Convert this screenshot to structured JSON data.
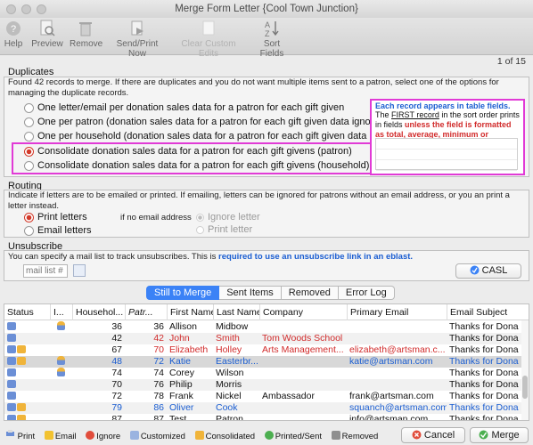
{
  "window": {
    "title": "Merge Form Letter {Cool Town Junction}"
  },
  "toolbar": {
    "help": "Help",
    "preview": "Preview",
    "remove": "Remove",
    "send_print": "Send/Print Now",
    "clear_custom": "Clear Custom Edits",
    "sort_fields": "Sort Fields"
  },
  "page_counter": "1 of 15",
  "duplicates": {
    "title": "Duplicates",
    "description": "Found 42 records to merge.  If there are duplicates and you do not want multiple items sent to a patron, select one of the options for managing the duplicate records.",
    "options": [
      {
        "label": "One letter/email per donation sales data for a patron for each gift given",
        "selected": false
      },
      {
        "label": "One per patron (donation sales data for a patron for each gift given data ignore",
        "selected": false
      },
      {
        "label": "One per household (donation sales data for a patron for each gift given data ig",
        "selected": false
      },
      {
        "label": "Consolidate donation sales data for a patron for each gift givens (patron)",
        "selected": true
      },
      {
        "label": "Consolidate donation sales data for a patron for each gift givens (household)",
        "selected": false
      }
    ],
    "side_title": "Each record appears in table fields.",
    "side_text_a": "The ",
    "side_text_first": "FIRST record",
    "side_text_b": " in the sort order prints in fields ",
    "side_text_red": "unless the field is formatted as total, average, minimum or"
  },
  "routing": {
    "title": "Routing",
    "description": "Indicate if letters are to be emailed or printed.  If emailing, letters can be ignored for patrons without an email address, or you an print a letter instead.",
    "print_letters": "Print letters",
    "email_letters": "Email letters",
    "if_no_email": "if no email address",
    "ignore_letter": "Ignore letter",
    "print_letter": "Print letter"
  },
  "unsubscribe": {
    "title": "Unsubscribe",
    "description_a": "You can specify a mail list to track unsubscribes.  This is ",
    "description_link": "required to use an unsubscribe link in an eblast.",
    "placeholder": "mail list #",
    "casl": "CASL"
  },
  "tabs": [
    "Still to Merge",
    "Sent Items",
    "Removed",
    "Error Log"
  ],
  "table": {
    "columns": [
      "Status",
      "I...",
      "Househol...",
      "Patr...",
      "First Name",
      "Last Name",
      "Company",
      "Primary Email",
      "Email Subject"
    ],
    "rows": [
      {
        "household": "36",
        "patron": "36",
        "first": "Allison",
        "last": "Midbow",
        "company": "",
        "email": "",
        "subject": "Thanks for Dona",
        "color": "black",
        "icons": [
          "print"
        ],
        "person": true
      },
      {
        "household": "42",
        "patron": "42",
        "first": "John",
        "last": "Smith",
        "company": "Tom Woods School",
        "email": "",
        "subject": "Thanks for Dona",
        "color": "red",
        "icons": [
          "print"
        ],
        "person": false
      },
      {
        "household": "67",
        "patron": "70",
        "first": "Elizabeth",
        "last": "Holley",
        "company": "Arts Management...",
        "email": "elizabeth@artsman.c...",
        "subject": "Thanks for Dona",
        "color": "red",
        "icons": [
          "print",
          "consolidated"
        ],
        "person": false
      },
      {
        "household": "48",
        "patron": "72",
        "first": "Katie",
        "last": "Easterbr...",
        "company": "",
        "email": "katie@artsman.com",
        "subject": "Thanks for Dona",
        "color": "blue",
        "icons": [
          "print",
          "consolidated"
        ],
        "person": true
      },
      {
        "household": "74",
        "patron": "74",
        "first": "Corey",
        "last": "Wilson",
        "company": "",
        "email": "",
        "subject": "Thanks for Dona",
        "color": "black",
        "icons": [
          "print"
        ],
        "person": true
      },
      {
        "household": "70",
        "patron": "76",
        "first": "Philip",
        "last": "Morris",
        "company": "",
        "email": "",
        "subject": "Thanks for Dona",
        "color": "black",
        "icons": [
          "print"
        ],
        "person": false
      },
      {
        "household": "72",
        "patron": "78",
        "first": "Frank",
        "last": "Nickel",
        "company": "Ambassador",
        "email": "frank@artsman.com",
        "subject": "Thanks for Dona",
        "color": "black",
        "icons": [
          "print"
        ],
        "person": false
      },
      {
        "household": "79",
        "patron": "86",
        "first": "Oliver",
        "last": "Cook",
        "company": "",
        "email": "squanch@artsman.com",
        "subject": "Thanks for Dona",
        "color": "blue",
        "icons": [
          "print",
          "consolidated"
        ],
        "person": false
      },
      {
        "household": "87",
        "patron": "87",
        "first": "Test",
        "last": "Patron",
        "company": "",
        "email": "info@artsman.com",
        "subject": "Thanks for Dona",
        "color": "black",
        "icons": [
          "print",
          "consolidated"
        ],
        "person": false
      }
    ]
  },
  "legend": {
    "print": "Print",
    "email": "Email",
    "ignore": "Ignore",
    "customized": "Customized",
    "consolidated": "Consolidated",
    "printed_sent": "Printed/Sent",
    "removed": "Removed"
  },
  "buttons": {
    "cancel": "Cancel",
    "merge": "Merge"
  },
  "colors": {
    "accent": "#3b82f6",
    "highlight": "#e13ad6",
    "red_text": "#d12b2b",
    "blue_text": "#1a5dd1"
  }
}
